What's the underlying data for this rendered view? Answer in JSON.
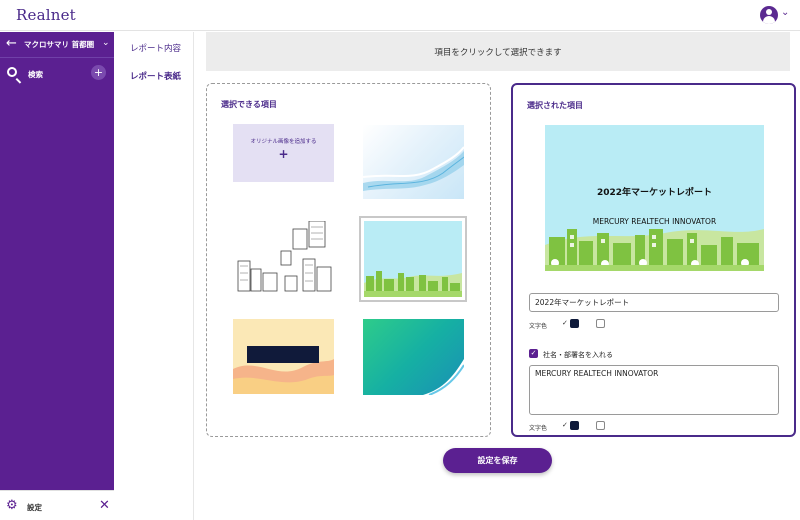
{
  "app": {
    "brand": "Realnet"
  },
  "sidebar": {
    "section_title": "マクロサマリ 首都圏",
    "search_label": "検索",
    "settings_label": "設定"
  },
  "submenu": {
    "items": [
      {
        "label": "レポート内容",
        "active": false
      },
      {
        "label": "レポート表紙",
        "active": true
      }
    ]
  },
  "main": {
    "banner_text": "項目をクリックして選択できます",
    "available": {
      "title": "選択できる項目",
      "add_image_label": "オリジナル画像を追加する",
      "thumbnails": [
        "add-original",
        "wave",
        "city-sketch",
        "city-skyline",
        "orange-shapes",
        "teal-gradient"
      ],
      "selected_thumbnail": "city-skyline"
    },
    "selected": {
      "title": "選択された項目",
      "preview_title": "2022年マーケットレポート",
      "preview_subtitle": "MERCURY REALTECH INNOVATOR",
      "title_field_value": "2022年マーケットレポート",
      "text_color_label": "文字色",
      "include_company_label": "社名・部署名を入れる",
      "include_company_checked": true,
      "company_field_value": "MERCURY REALTECH INNOVATOR",
      "company_text_color_label": "文字色"
    },
    "save_button": "設定を保存"
  },
  "colors": {
    "brand_purple": "#5b2091",
    "text_dark": "#0e1a3a",
    "sky": "#b9ecf5",
    "city_green": "#7fc241"
  }
}
